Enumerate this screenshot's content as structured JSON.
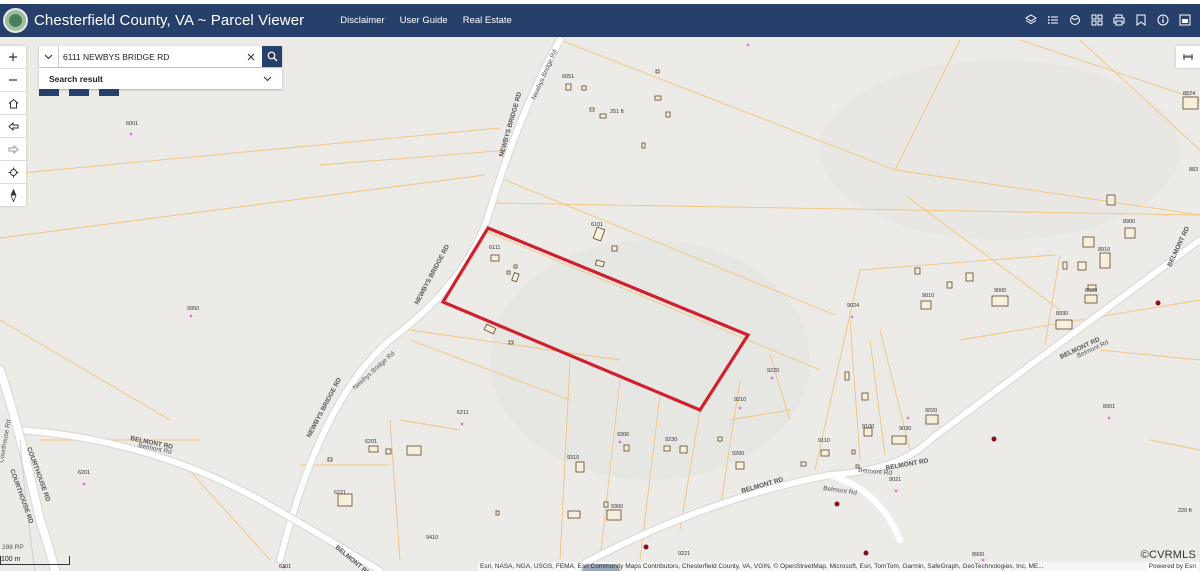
{
  "header": {
    "title": "Chesterfield County, VA ~ Parcel Viewer",
    "nav": [
      "Disclaimer",
      "User Guide",
      "Real Estate"
    ],
    "tools": [
      "layers-icon",
      "list-icon",
      "basemap-icon",
      "grid-icon",
      "print-icon",
      "bookmark-icon",
      "info-icon",
      "share-icon"
    ]
  },
  "search": {
    "value": "6111 NEWBYS BRIDGE RD",
    "result_label": "Search result"
  },
  "map": {
    "road_labels": [
      "NEWBYS BRIDGE RD",
      "Newbys Bridge Rd",
      "NEWBYS BRIDGE RD",
      "Newbys Bridge Rd",
      "NEWBYS BRIDGE RD",
      "BELMONT RD",
      "Belmont Rd",
      "BELMONT RD",
      "Belmont Rd",
      "BELMONT RD",
      "Belmont Rd",
      "BELMONT RD",
      "BELMONT RD",
      "Belmont Rd",
      "BELMONT RD",
      "COURTHOUSE RD",
      "COURTHOUSE RD",
      "Courthouse Rd",
      "288 RP"
    ],
    "parcel_labels": [
      "6051",
      "251 ft",
      "6001",
      "6101",
      "6111",
      "9950",
      "9024",
      "9220",
      "9210",
      "6211",
      "6201",
      "9306",
      "9310",
      "9230",
      "9200",
      "9110",
      "9100",
      "9030",
      "9020",
      "9021",
      "9010",
      "9000",
      "8930",
      "8910",
      "8900",
      "8920",
      "8901",
      "6221",
      "9300",
      "9410",
      "6201",
      "6301",
      "9221",
      "8824",
      "883",
      "220 ft",
      "8900"
    ],
    "scale": "100 m"
  },
  "attribution": "Esri, NASA, NGA, USGS, FEMA, Esri Community Maps Contributors, Chesterfield County, VA, VGIN, © OpenStreetMap, Microsoft, Esri, TomTom, Garmin, SafeGraph, GeoTechnologies, Inc, ME...",
  "powered_by": "Powered by Esri",
  "watermark": "©CVRMLS",
  "colors": {
    "header": "#27406b",
    "parcel_line": "#f2c47c",
    "highlight": "#d0202e",
    "road": "#ffffff"
  }
}
